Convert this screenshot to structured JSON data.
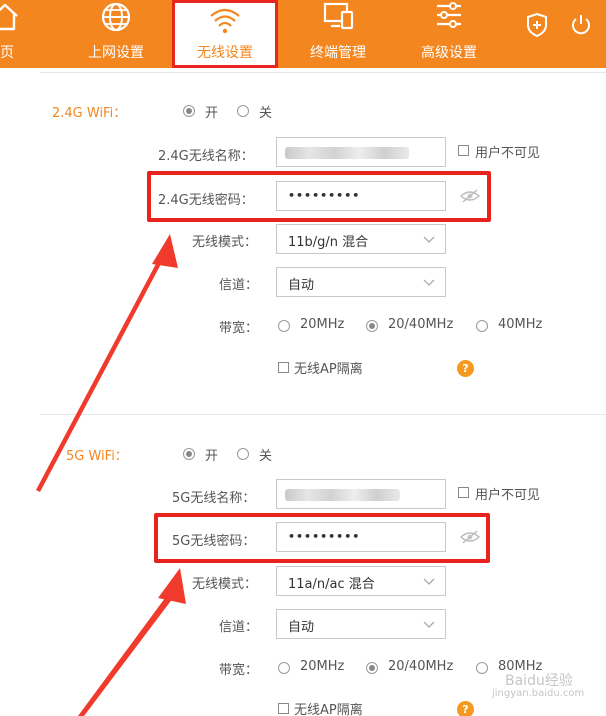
{
  "nav": {
    "items": [
      {
        "label": "首页",
        "icon": "home-icon"
      },
      {
        "label": "上网设置",
        "icon": "globe-icon"
      },
      {
        "label": "无线设置",
        "icon": "wifi-icon",
        "active": true
      },
      {
        "label": "终端管理",
        "icon": "devices-icon"
      },
      {
        "label": "高级设置",
        "icon": "sliders-icon"
      }
    ],
    "partial_home_label": "页",
    "right_icons": [
      "shield-plus-icon",
      "power-icon"
    ]
  },
  "wifi24": {
    "section_label": "2.4G WiFi：",
    "on_label": "开",
    "off_label": "关",
    "enabled": true,
    "name_label": "2.4G无线名称：",
    "name_value": "",
    "hide_ssid_label": "用户不可见",
    "password_label": "2.4G无线密码：",
    "password_value": "•••••••••",
    "mode_label": "无线模式：",
    "mode_value": "11b/g/n 混合",
    "channel_label": "信道：",
    "channel_value": "自动",
    "bandwidth_label": "带宽：",
    "bandwidth_options": [
      "20MHz",
      "20/40MHz",
      "40MHz"
    ],
    "bandwidth_selected": "20/40MHz",
    "ap_isolation_label": "无线AP隔离"
  },
  "wifi5": {
    "section_label": "5G WiFi：",
    "on_label": "开",
    "off_label": "关",
    "enabled": true,
    "name_label": "5G无线名称：",
    "name_value": "",
    "hide_ssid_label": "用户不可见",
    "password_label": "5G无线密码：",
    "password_value": "•••••••••",
    "mode_label": "无线模式：",
    "mode_value": "11a/n/ac 混合",
    "channel_label": "信道：",
    "channel_value": "自动",
    "bandwidth_label": "带宽：",
    "bandwidth_options": [
      "20MHz",
      "20/40MHz",
      "80MHz"
    ],
    "bandwidth_selected": "20/40MHz",
    "ap_isolation_label": "无线AP隔离"
  },
  "help_symbol": "?",
  "watermark": {
    "line1": "Baidu经验",
    "line2": "jingyan.baidu.com"
  },
  "colors": {
    "brand_orange": "#f4861f",
    "highlight_red": "#e8231d",
    "arrow_red": "#f03a2b"
  }
}
